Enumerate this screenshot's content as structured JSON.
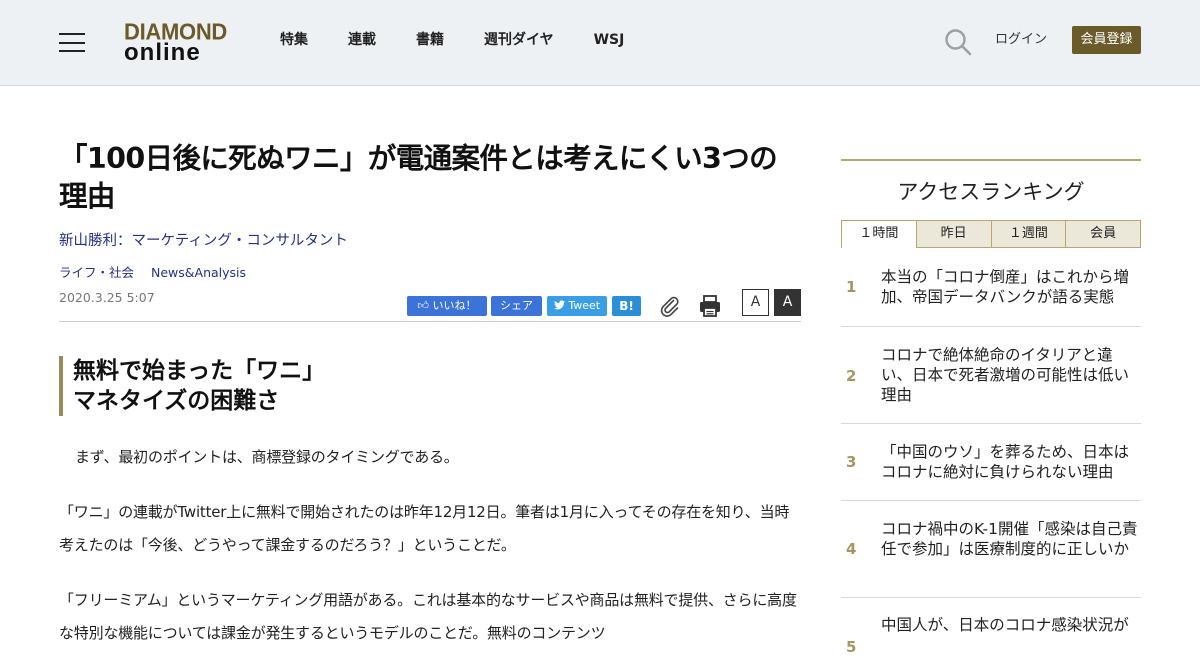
{
  "header": {
    "logo_top": "DIAMOND",
    "logo_bottom": "online",
    "nav": [
      "特集",
      "連載",
      "書籍",
      "週刊ダイヤ",
      "WSJ"
    ],
    "login": "ログイン",
    "register": "会員登録"
  },
  "article": {
    "title": "「100日後に死ぬワニ」が電通案件とは考えにくい3つの理由",
    "author": "新山勝利：マーケティング・コンサルタント",
    "tags": [
      "ライフ・社会",
      "News&Analysis"
    ],
    "date": "2020.3.25 5:07",
    "share": {
      "like": "いいね！",
      "share": "シェア",
      "tweet": "Tweet",
      "hatena": "B!"
    },
    "font_small": "A",
    "font_large": "A",
    "subheading_line1": "無料で始まった「ワニ」",
    "subheading_line2": "マネタイズの困難さ",
    "paragraphs": [
      "まず、最初のポイントは、商標登録のタイミングである。",
      "「ワニ」の連載がTwitter上に無料で開始されたのは昨年12月12日。筆者は1月に入ってその存在を知り、当時考えたのは「今後、どうやって課金するのだろう？」ということだ。",
      "「フリーミアム」というマーケティング用語がある。これは基本的なサービスや商品は無料で提供、さらに高度な特別な機能については課金が発生するというモデルのことだ。無料のコンテンツ"
    ]
  },
  "sidebar": {
    "title": "アクセスランキング",
    "tabs": [
      "１時間",
      "昨日",
      "１週間",
      "会員"
    ],
    "rankings": [
      {
        "rank": "1",
        "text": "本当の「コロナ倒産」はこれから増加、帝国データバンクが語る実態"
      },
      {
        "rank": "2",
        "text": "コロナで絶体絶命のイタリアと違い、日本で死者激増の可能性は低い理由"
      },
      {
        "rank": "3",
        "text": "「中国のウソ」を葬るため、日本はコロナに絶対に負けられない理由"
      },
      {
        "rank": "4",
        "text": "コロナ禍中のK-1開催「感染は自己責任で参加」は医療制度的に正しいか"
      },
      {
        "rank": "5",
        "text": "中国人が、日本のコロナ感染状況が"
      }
    ]
  }
}
